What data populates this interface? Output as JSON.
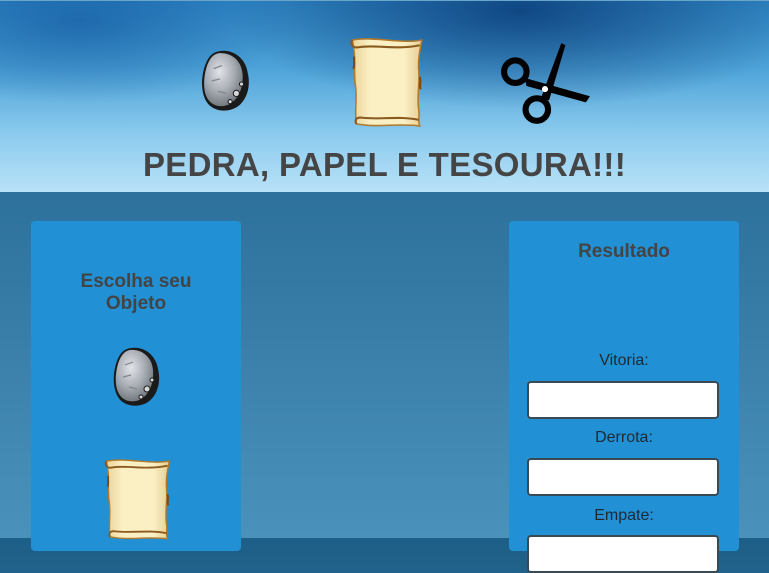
{
  "header": {
    "title": "PEDRA, PAPEL E TESOURA!!!",
    "icons": [
      "rock-icon",
      "paper-scroll-icon",
      "scissors-icon"
    ]
  },
  "choose_panel": {
    "title": "Escolha seu Objeto",
    "options": [
      "rock-icon",
      "paper-scroll-icon"
    ]
  },
  "result_panel": {
    "title": "Resultado",
    "victory_label": "Vitoria:",
    "defeat_label": "Derrota:",
    "draw_label": "Empate:",
    "victory_value": "",
    "defeat_value": "",
    "draw_value": ""
  },
  "colors": {
    "panel": "#2190d4",
    "title_text": "#454545"
  }
}
